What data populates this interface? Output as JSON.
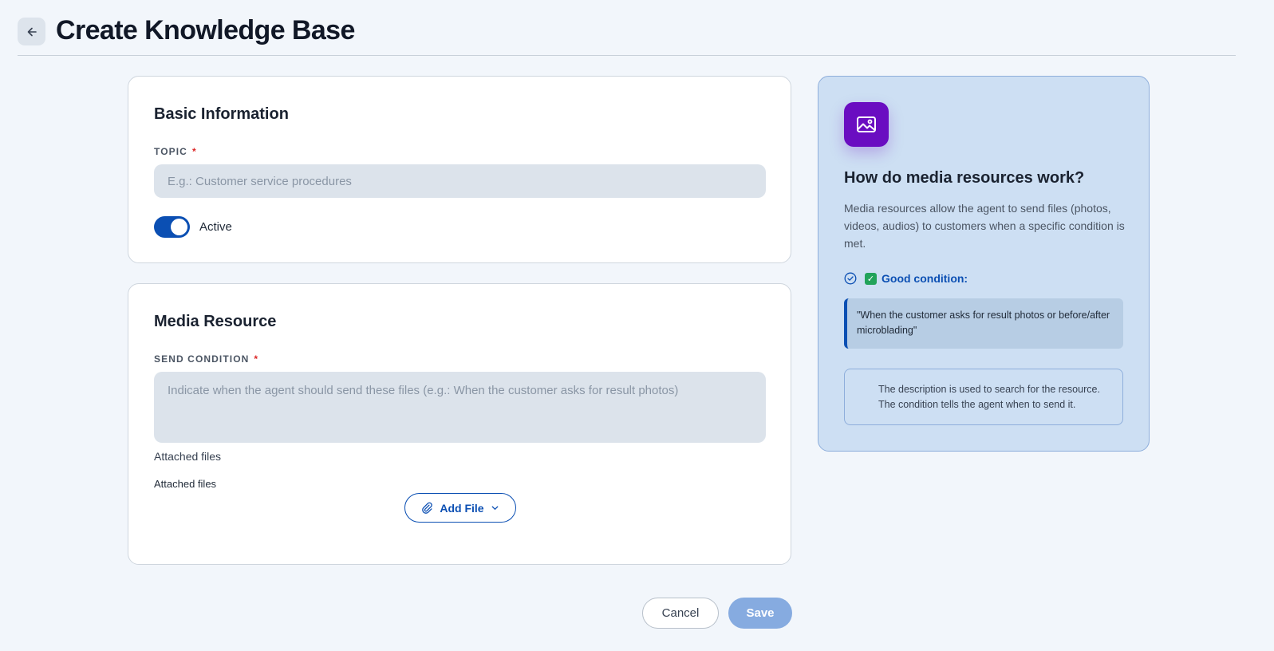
{
  "header": {
    "title": "Create Knowledge Base",
    "back_icon": "arrow-left-icon"
  },
  "basic_info": {
    "title": "Basic Information",
    "topic_label": "TOPIC",
    "required_mark": "*",
    "topic_value": "",
    "topic_placeholder": "E.g.: Customer service procedures",
    "active_label": "Active",
    "active_on": true
  },
  "media_resource": {
    "title": "Media Resource",
    "condition_label": "SEND CONDITION",
    "required_mark": "*",
    "condition_value": "",
    "condition_placeholder": "Indicate when the agent should send these files (e.g.: When the customer asks for result photos)",
    "attached_heading": "Attached files",
    "attached_sublabel": "Attached files",
    "add_file_label": "Add File"
  },
  "info_panel": {
    "icon": "image-icon",
    "title": "How do media resources work?",
    "description": "Media resources allow the agent to send files (photos, videos, audios) to customers when a specific condition is met.",
    "good_condition_label": "Good condition:",
    "example_quote": "\"When the customer asks for result photos or before/after microblading\"",
    "note_line1": "The description is used to search for the resource.",
    "note_line2": "The condition tells the agent when to send it."
  },
  "footer": {
    "cancel_label": "Cancel",
    "save_label": "Save"
  },
  "colors": {
    "accent": "#0b4fb3",
    "save_disabled": "#86abe0",
    "icon_tile": "#6a0dc1",
    "info_panel_bg": "#cddff3"
  }
}
